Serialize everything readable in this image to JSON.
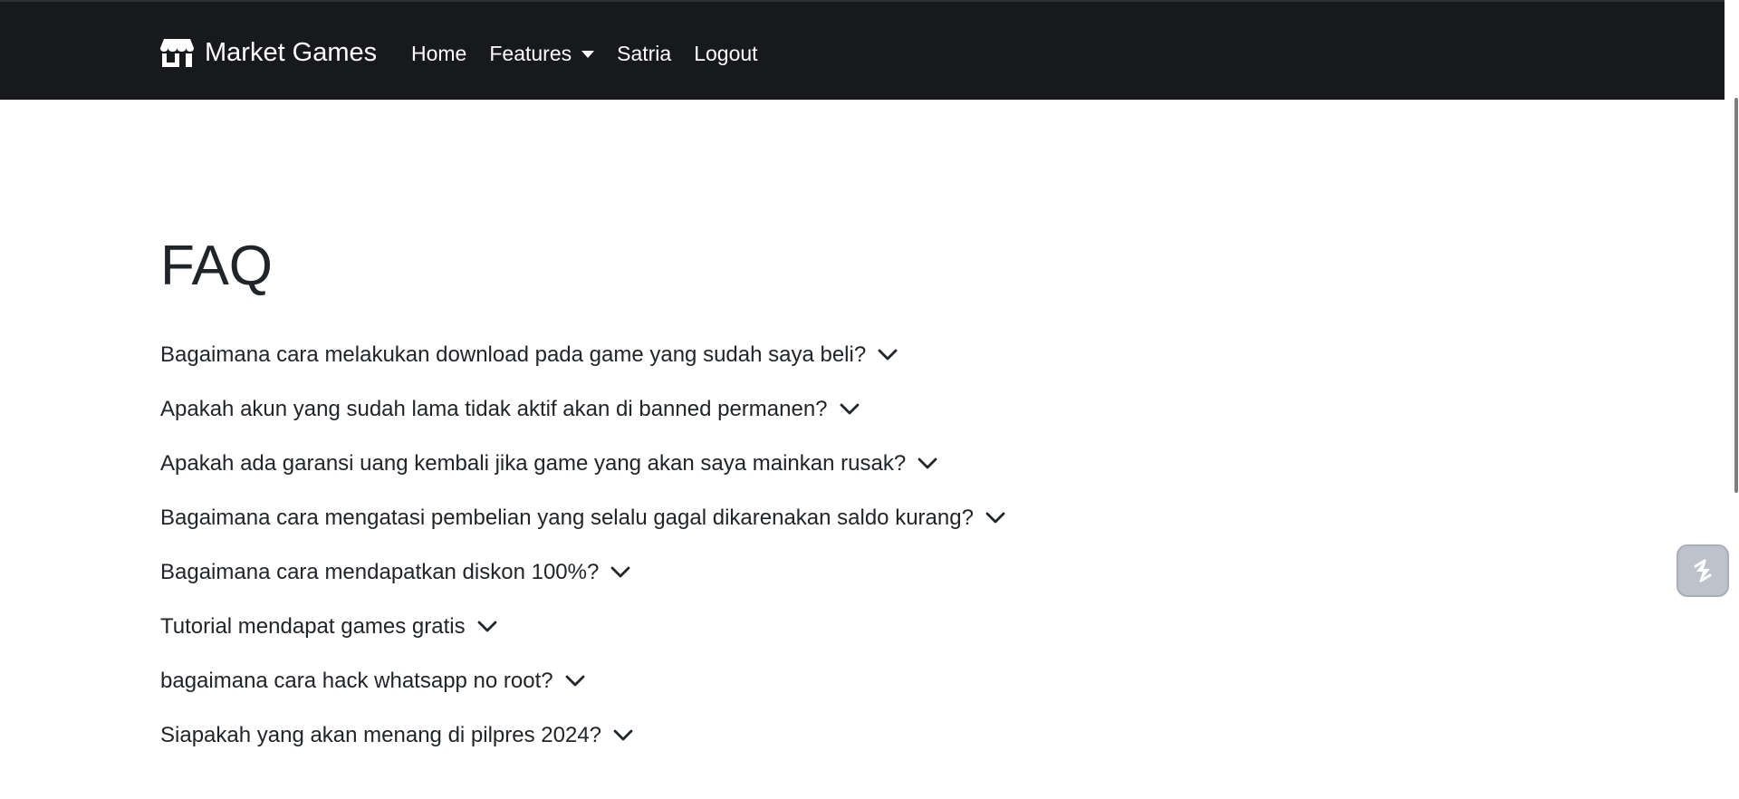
{
  "navbar": {
    "brand": "Market Games",
    "brand_icon": "store-icon",
    "links": [
      {
        "label": "Home"
      },
      {
        "label": "Features",
        "dropdown": true
      },
      {
        "label": "Satria"
      },
      {
        "label": "Logout"
      }
    ]
  },
  "page": {
    "title": "FAQ"
  },
  "faq": [
    "Bagaimana cara melakukan download pada game yang sudah saya beli?",
    "Apakah akun yang sudah lama tidak aktif akan di banned permanen?",
    "Apakah ada garansi uang kembali jika game yang akan saya mainkan rusak?",
    "Bagaimana cara mengatasi pembelian yang selalu gagal dikarenakan saldo kurang?",
    "Bagaimana cara mendapatkan diskon 100%?",
    "Tutorial mendapat games gratis",
    "bagaimana cara hack whatsapp no root?",
    "Siapakah yang akan menang di pilpres 2024?"
  ],
  "floating_button": {
    "icon": "lightning-icon"
  },
  "colors": {
    "navbar_bg": "#17191c",
    "text": "#212529",
    "nav_text": "#ffffff"
  }
}
